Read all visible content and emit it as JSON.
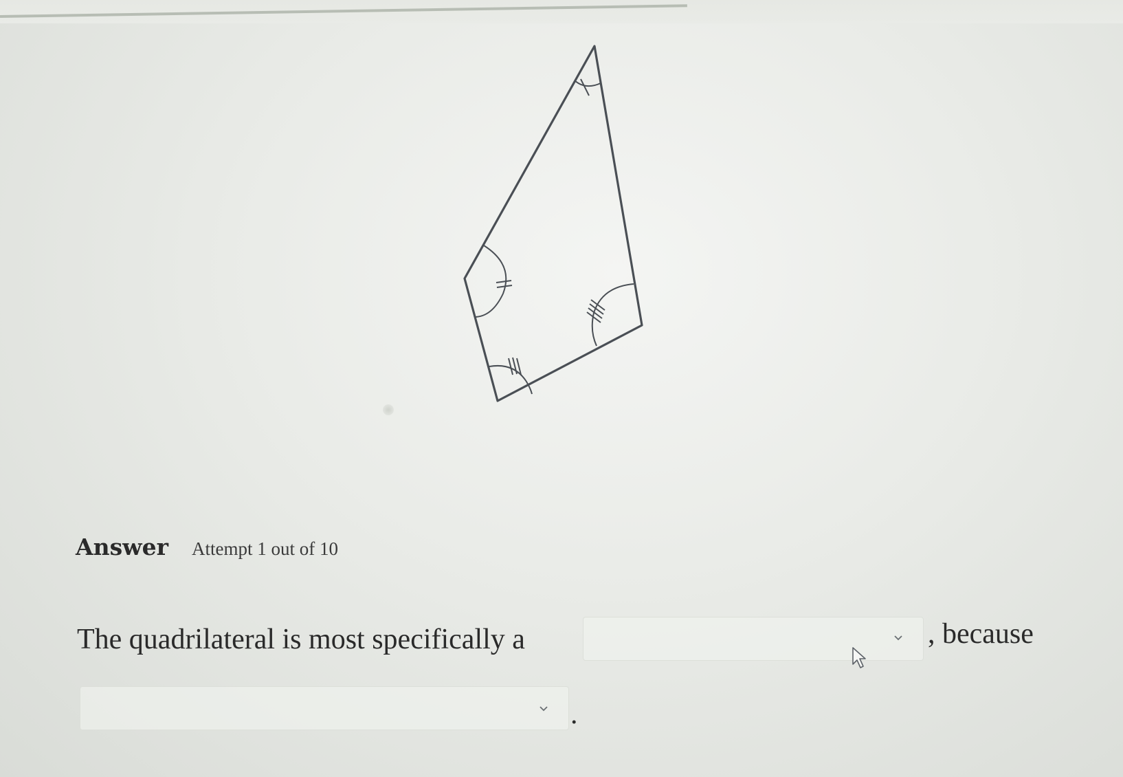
{
  "answer": {
    "heading": "Answer",
    "attempt": "Attempt 1 out of 10"
  },
  "question": {
    "prefix": "The quadrilateral is most specifically a",
    "middle": ", because",
    "end": ".",
    "dropdown_shape": {
      "selected": "",
      "icon": "chevron-down-icon"
    },
    "dropdown_reason": {
      "selected": "",
      "icon": "chevron-down-icon"
    }
  },
  "figure": {
    "shape": "quadrilateral",
    "stroke_color": "#4a4f55",
    "angle_marks": [
      "1 tick",
      "2 ticks",
      "3 ticks",
      "4 ticks"
    ]
  }
}
